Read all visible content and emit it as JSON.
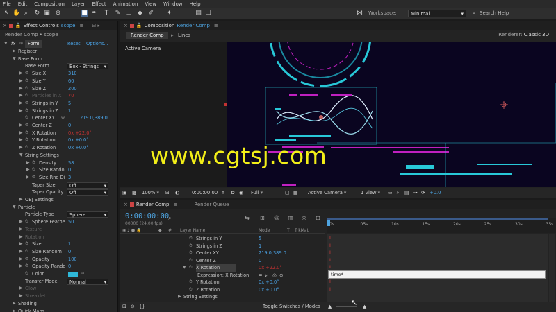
{
  "menu": [
    "File",
    "Edit",
    "Composition",
    "Layer",
    "Effect",
    "Animation",
    "View",
    "Window",
    "Help"
  ],
  "workspace": {
    "label": "Workspace:",
    "value": "Minimal"
  },
  "search_help": "Search Help",
  "effect_controls": {
    "tab_label": "Effect Controls",
    "tab_target": "scope",
    "subtitle": "Render Comp • scope",
    "effect_name": "Form",
    "reset": "Reset",
    "options": "Options...",
    "rows": [
      {
        "indent": 1,
        "twirl": "▶",
        "label": "Register"
      },
      {
        "indent": 1,
        "twirl": "▼",
        "label": "Base Form"
      },
      {
        "indent": 2,
        "label": "Base Form",
        "dropdown": "Box - Strings"
      },
      {
        "indent": 2,
        "twirl": "▶",
        "stop": true,
        "label": "Size X",
        "value": "310"
      },
      {
        "indent": 2,
        "twirl": "▶",
        "stop": true,
        "label": "Size Y",
        "value": "60"
      },
      {
        "indent": 2,
        "twirl": "▶",
        "stop": true,
        "label": "Size Z",
        "value": "200"
      },
      {
        "indent": 2,
        "twirl": "▶",
        "stop": true,
        "label": "Particles in X",
        "value": "70",
        "dim": true
      },
      {
        "indent": 2,
        "twirl": "▶",
        "stop": true,
        "label": "Strings in Y",
        "value": "5"
      },
      {
        "indent": 2,
        "twirl": "▶",
        "stop": true,
        "label": "Strings in Z",
        "value": "1"
      },
      {
        "indent": 2,
        "stop": true,
        "label": "Center XY",
        "value": "219.0,389.0",
        "target": true
      },
      {
        "indent": 2,
        "twirl": "▶",
        "stop": true,
        "label": "Center Z",
        "value": "0"
      },
      {
        "indent": 2,
        "twirl": "▶",
        "stop": true,
        "label": "X Rotation",
        "value": "0x +22.0°",
        "red": true
      },
      {
        "indent": 2,
        "twirl": "▶",
        "stop": true,
        "label": "Y Rotation",
        "value": "0x +0.0°"
      },
      {
        "indent": 2,
        "twirl": "▶",
        "stop": true,
        "label": "Z Rotation",
        "value": "0x +0.0°"
      },
      {
        "indent": 2,
        "twirl": "▼",
        "label": "String Settings"
      },
      {
        "indent": 3,
        "twirl": "▶",
        "stop": true,
        "label": "Density",
        "value": "58"
      },
      {
        "indent": 3,
        "twirl": "▶",
        "stop": true,
        "label": "Size Rando",
        "value": "0"
      },
      {
        "indent": 3,
        "twirl": "▶",
        "stop": true,
        "label": "Size Rnd Di",
        "value": "3"
      },
      {
        "indent": 3,
        "label": "Taper Size",
        "dropdown": "Off"
      },
      {
        "indent": 3,
        "label": "Taper Opacity",
        "dropdown": "Off"
      },
      {
        "indent": 2,
        "twirl": "▶",
        "label": "OBJ Settings"
      },
      {
        "indent": 1,
        "twirl": "▼",
        "label": "Particle"
      },
      {
        "indent": 2,
        "label": "Particle Type",
        "dropdown": "Sphere"
      },
      {
        "indent": 2,
        "twirl": "▶",
        "stop": true,
        "label": "Sphere Feathe",
        "value": "50"
      },
      {
        "indent": 2,
        "twirl": "▶",
        "label": "Texture",
        "dim": true
      },
      {
        "indent": 2,
        "twirl": "▶",
        "label": "Rotation",
        "dim": true
      },
      {
        "indent": 2,
        "twirl": "▶",
        "stop": true,
        "label": "Size",
        "value": "1"
      },
      {
        "indent": 2,
        "twirl": "▶",
        "stop": true,
        "label": "Size Random",
        "value": "0"
      },
      {
        "indent": 2,
        "twirl": "▶",
        "stop": true,
        "label": "Opacity",
        "value": "100"
      },
      {
        "indent": 2,
        "twirl": "▶",
        "stop": true,
        "label": "Opacity Rando",
        "value": "0"
      },
      {
        "indent": 2,
        "stop": true,
        "label": "Color",
        "swatch": "#2fb8d8"
      },
      {
        "indent": 2,
        "label": "Transfer Mode",
        "dropdown": "Normal"
      },
      {
        "indent": 2,
        "twirl": "▶",
        "label": "Glow",
        "dim": true
      },
      {
        "indent": 2,
        "twirl": "▶",
        "label": "Streaklet",
        "dim": true
      },
      {
        "indent": 1,
        "twirl": "▶",
        "label": "Shading"
      },
      {
        "indent": 1,
        "twirl": "▶",
        "label": "Quick Maps"
      }
    ]
  },
  "composition": {
    "tab_label": "Composition",
    "tab_target": "Render Comp",
    "subtabs": [
      "Render Comp",
      "Lines"
    ],
    "renderer_label": "Renderer:",
    "renderer_value": "Classic 3D",
    "active_camera": "Active Camera",
    "viewer_bar": {
      "zoom": "100%",
      "time": "0:00:00:00",
      "resolution": "Full",
      "view": "Active Camera",
      "views": "1 View",
      "exposure": "+0.0"
    }
  },
  "watermark": "www.cgtsj.com",
  "timeline": {
    "tab_label": "Render Comp",
    "queue_label": "Render Queue",
    "timecode": "0:00:00:00",
    "fps": "00000 (24.00 fps)",
    "columns": {
      "layer_name": "Layer Name",
      "mode": "Mode",
      "t": "T",
      "trkmat": "TrkMat"
    },
    "ruler_ticks": [
      "0s",
      "05s",
      "10s",
      "15s",
      "20s",
      "25s",
      "30s",
      "35s"
    ],
    "rows": [
      {
        "label": "Strings in Y",
        "value": "5"
      },
      {
        "label": "Strings in Z",
        "value": "1"
      },
      {
        "label": "Center XY",
        "value": "219.0,389.0"
      },
      {
        "label": "Center Z",
        "value": "0"
      },
      {
        "label": "X Rotation",
        "value": "0x +22.0°",
        "red": true,
        "twirl": "▼",
        "selected": true
      },
      {
        "label": "Expression: X Rotation",
        "expr": true
      },
      {
        "label": "Y Rotation",
        "value": "0x +0.0°"
      },
      {
        "label": "Z Rotation",
        "value": "0x +0.0°"
      },
      {
        "label": "String Settings",
        "twirl": "▶",
        "noStop": true
      }
    ],
    "expression_text": "time*",
    "toggle_label": "Toggle Switches / Modes"
  },
  "colors": {
    "accent": "#4ea4e0",
    "keyframe_red": "#d43a3a",
    "canvas": "#0a0520",
    "cyan": "#28c8d8",
    "magenta": "#c020c0"
  }
}
